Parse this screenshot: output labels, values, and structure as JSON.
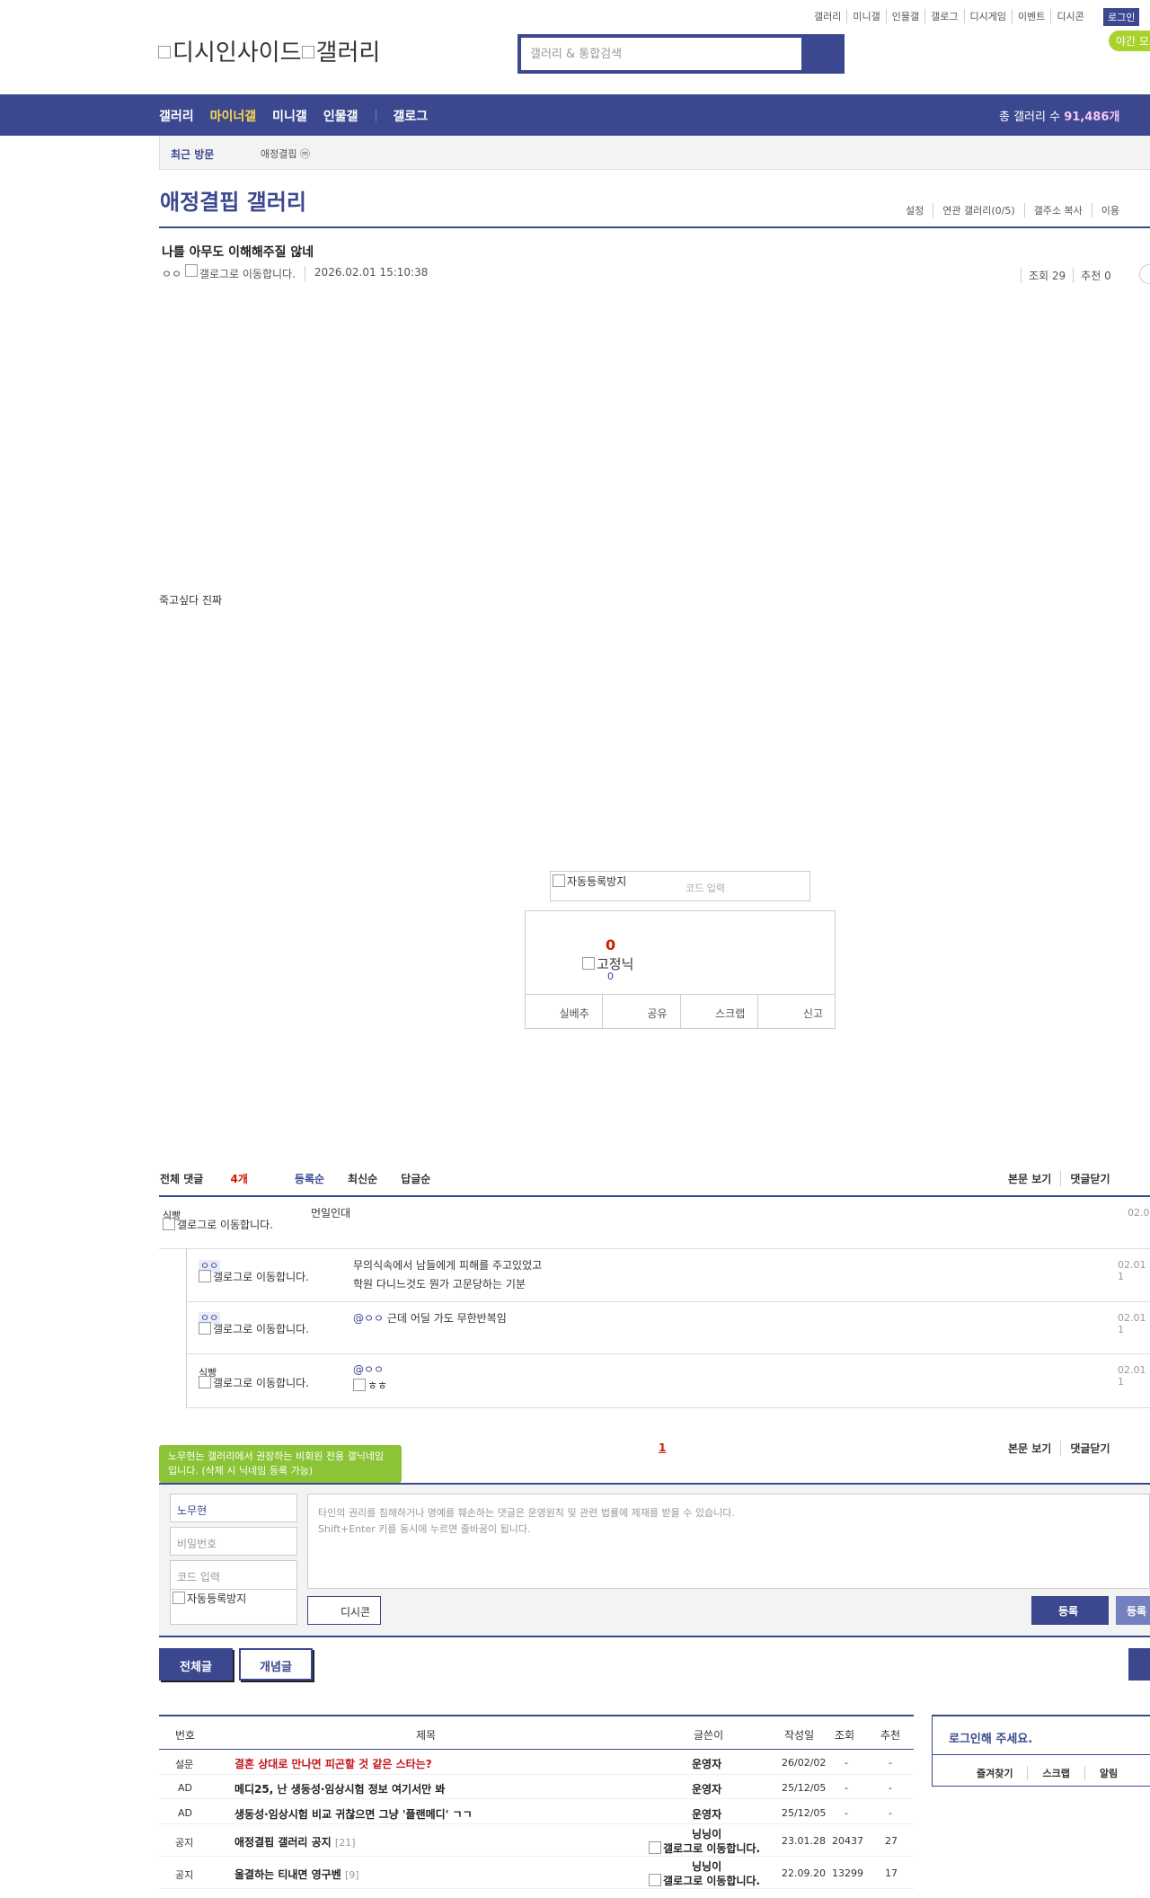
{
  "util_links": [
    "갤러리",
    "미니갤",
    "인물갤",
    "갤로그",
    "디시게임",
    "이벤트",
    "디시콘"
  ],
  "login_badge": "로그인",
  "night_mode": "야간 모",
  "logo_alt": {
    "main": "디시인사이드",
    "sub": "갤러리"
  },
  "search": {
    "placeholder": "갤러리 & 통합검색"
  },
  "nav": {
    "items": [
      "갤러리",
      "마이너갤",
      "미니갤",
      "인물갤",
      "갤로그"
    ],
    "active": "마이너갤"
  },
  "total": {
    "label": "총 갤러리 수",
    "value": "91,486개"
  },
  "recent": {
    "label": "최근 방문",
    "item": "애정결핍 ⓜ"
  },
  "gallery": {
    "title": "애정결핍 갤러리",
    "tools": [
      "설정",
      "연관 갤러리(0/5)",
      "갤주소 복사",
      "이용"
    ]
  },
  "post": {
    "title": "나를 아무도 이해해주질 않네",
    "nickname": "ㅇㅇ",
    "gallog_alt": "갤로그로 이동합니다.",
    "date": "2026.02.01 15:10:38",
    "views_label": "조회 29",
    "recommend_label": "추천 0",
    "body": "죽고싶다 진짜"
  },
  "captcha": {
    "img_alt": "자동등록방지",
    "placeholder": "코드 입력"
  },
  "recommend_box": {
    "count": "0",
    "fixed_nick": "고정닉",
    "fixed_count": "0",
    "buttons": [
      "실베추",
      "공유",
      "스크랩",
      "신고"
    ]
  },
  "comments": {
    "header": {
      "total_label": "전체 댓글",
      "total_count": "4개",
      "sorts": [
        "등록순",
        "최신순",
        "답글순"
      ]
    },
    "tools": [
      "본문 보기",
      "댓글닫기"
    ],
    "list": [
      {
        "nick": "식빵",
        "gallog_alt": "갤로그로 이동합니다.",
        "text": "먼일인대",
        "date": "02.0"
      },
      {
        "nick": "ㅇㅇ",
        "gallog_alt": "갤로그로 이동합니다.",
        "text1": "무의식속에서 남들에게 피해를 주고있었고",
        "text2": "학원 다니느것도 뭔가 고문당하는 기분",
        "date": "02.01 1"
      },
      {
        "nick": "ㅇㅇ",
        "gallog_alt": "갤로그로 이동합니다.",
        "mention": "@ㅇㅇ",
        "text": "근데 어딜 가도 무한반복임",
        "date": "02.01 1"
      },
      {
        "nick": "식빵",
        "gallog_alt": "갤로그로 이동합니다.",
        "mention": "@ㅇㅇ",
        "img_alt": "ㅎㅎ",
        "date": "02.01 1"
      }
    ],
    "page": "1"
  },
  "write": {
    "bubble": "노무현는 갤러리에서 권장하는 비회원 전용 갤닉네임입니다. (삭제 시 닉네임 등록 가능)",
    "nick_value": "노무현",
    "password_placeholder": "비밀번호",
    "code_placeholder": "코드 입력",
    "captcha_alt": "자동등록방지",
    "textarea_line1": "타인의 권리를 침해하거나 명예를 훼손하는 댓글은 운영원칙 및 관련 법률에 제재를 받을 수 있습니다.",
    "textarea_line2": "Shift+Enter 키를 동시에 누르면 줄바꿈이 됩니다.",
    "dccon": "디시콘",
    "register": "등록",
    "register2": "등록"
  },
  "tabs": {
    "all": "전체글",
    "concept": "개념글"
  },
  "list": {
    "headers": [
      "번호",
      "제목",
      "글쓴이",
      "작성일",
      "조회",
      "추천"
    ],
    "rows": [
      {
        "num": "설문",
        "subject": "결혼 상대로 만나면 피곤할 것 같은 스타는?",
        "count": "",
        "writer": "운영자",
        "date": "26/02/02",
        "views": "-",
        "rec": "-",
        "red": true
      },
      {
        "num": "AD",
        "subject": "메디25, 난 생동성·임상시험 정보 여기서만 봐",
        "count": "",
        "writer": "운영자",
        "date": "25/12/05",
        "views": "-",
        "rec": "-",
        "red": false
      },
      {
        "num": "AD",
        "subject": "생동성·임상시험 비교 귀찮으면 그냥 '플랜메디' ㄱㄱ",
        "count": "",
        "writer": "운영자",
        "date": "25/12/05",
        "views": "-",
        "rec": "-",
        "red": false
      },
      {
        "num": "공지",
        "subject": "애정결핍 갤러리 공지",
        "count": "[21]",
        "writer": "닝닝이",
        "writer_img": "갤로그로 이동합니다.",
        "date": "23.01.28",
        "views": "20437",
        "rec": "27",
        "red": false
      },
      {
        "num": "공지",
        "subject": "울결하는 티내면 영구벤",
        "count": "[9]",
        "writer": "닝닝이",
        "writer_img": "갤로그로 이동합니다.",
        "date": "22.09.20",
        "views": "13299",
        "rec": "17",
        "red": false
      }
    ]
  },
  "login_box": {
    "message": "로그인해 주세요.",
    "links": [
      "즐겨찾기",
      "스크랩",
      "알림"
    ]
  }
}
